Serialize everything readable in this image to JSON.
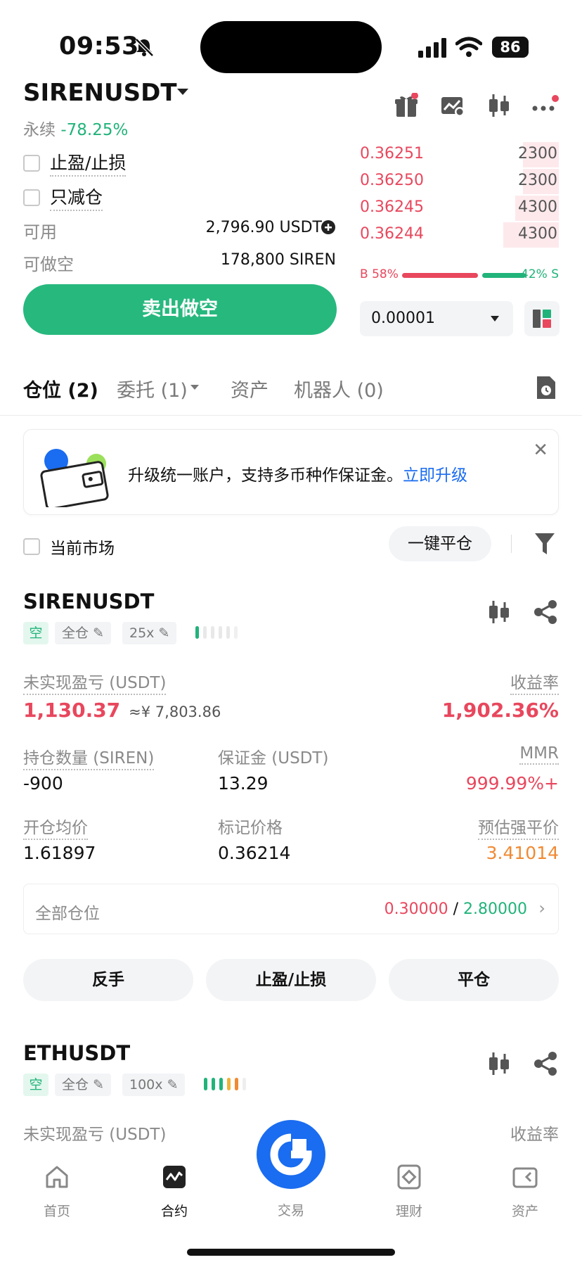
{
  "status_bar": {
    "time": "09:53",
    "battery": "86"
  },
  "header": {
    "pair": "SIRENUSDT",
    "contract_type": "永续",
    "change": "-78.25%"
  },
  "order_form": {
    "tp_sl_label": "止盈/止损",
    "reduce_only_label": "只减仓",
    "available_label": "可用",
    "available_value": "2,796.90 USDT",
    "max_short_label": "可做空",
    "max_short_value": "178,800 SIREN",
    "sell_button": "卖出做空"
  },
  "orderbook": {
    "asks": [
      {
        "price": "0.36251",
        "qty": "2300",
        "depth": 0.18
      },
      {
        "price": "0.36250",
        "qty": "2300",
        "depth": 0.18
      },
      {
        "price": "0.36245",
        "qty": "4300",
        "depth": 0.22
      },
      {
        "price": "0.36244",
        "qty": "4300",
        "depth": 0.28
      }
    ],
    "buy_ratio": "B 58%",
    "sell_ratio": "42% S",
    "step": "0.00001"
  },
  "tabs": [
    {
      "label": "仓位 (2)"
    },
    {
      "label": "委托 (1)"
    },
    {
      "label": "资产"
    },
    {
      "label": "机器人 (0)"
    }
  ],
  "promo": {
    "text": "升级统一账户，支持多币种作保证金。",
    "link": "立即升级",
    "close": "✕"
  },
  "positions_toolbar": {
    "current_market": "当前市场",
    "close_all": "一键平仓"
  },
  "positions": [
    {
      "symbol": "SIRENUSDT",
      "side": "空",
      "margin_mode": "全仓",
      "leverage": "25x",
      "unrealized_label": "未实现盈亏 (USDT)",
      "unrealized_value": "1,130.37",
      "unrealized_cny": "≈¥ 7,803.86",
      "roe_label": "收益率",
      "roe_value": "1,902.36%",
      "size_label": "持仓数量 (SIREN)",
      "size_value": "-900",
      "margin_label": "保证金 (USDT)",
      "margin_value": "13.29",
      "mmr_label": "MMR",
      "mmr_value": "999.99%+",
      "entry_label": "开仓均价",
      "entry_value": "1.61897",
      "mark_label": "标记价格",
      "mark_value": "0.36214",
      "liq_label": "预估强平价",
      "liq_value": "3.41014",
      "all_pos_label": "全部仓位",
      "all_pos_short": "0.30000",
      "all_pos_sep": "/",
      "all_pos_long": "2.80000",
      "btn_reverse": "反手",
      "btn_tpsl": "止盈/止损",
      "btn_close": "平仓"
    },
    {
      "symbol": "ETHUSDT",
      "side": "空",
      "margin_mode": "全仓",
      "leverage": "100x",
      "unrealized_label": "未实现盈亏 (USDT)",
      "roe_label": "收益率"
    }
  ],
  "bottom_nav": [
    {
      "label": "首页"
    },
    {
      "label": "合约"
    },
    {
      "label": "交易"
    },
    {
      "label": "理财"
    },
    {
      "label": "资产"
    }
  ],
  "colors": {
    "red": "#e8475d",
    "green": "#21b37a",
    "blue": "#1a6cf0",
    "orange": "#f08a33"
  }
}
